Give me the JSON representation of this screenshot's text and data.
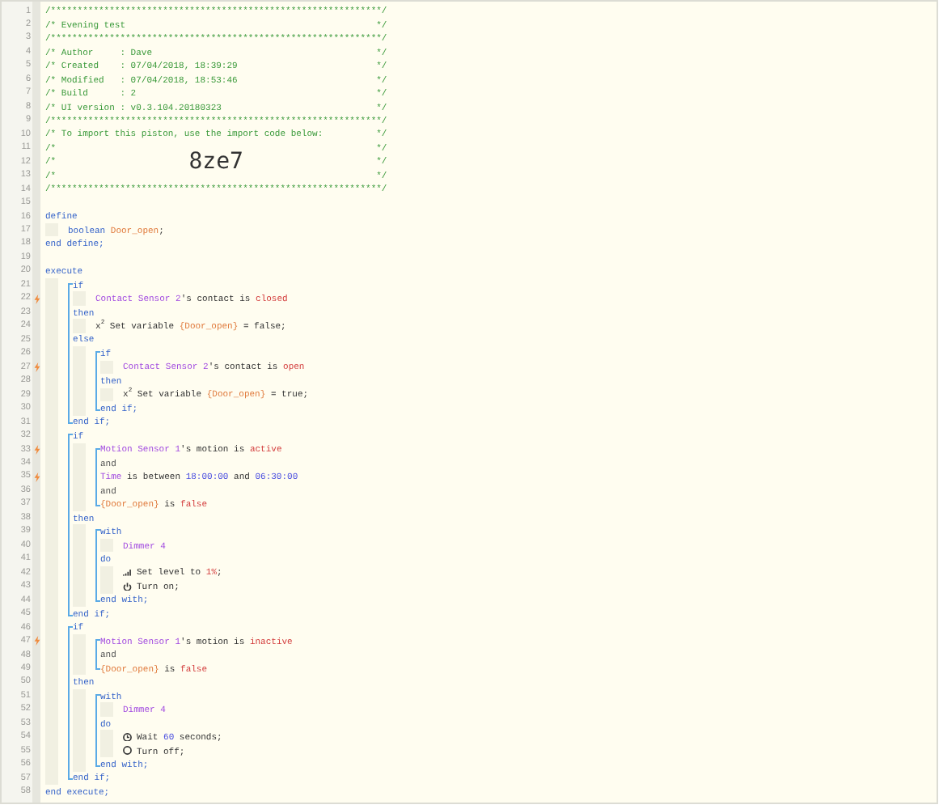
{
  "editor": {
    "lines": [
      {
        "kind": "line",
        "number": "1",
        "trigger": false,
        "tokens": [
          {
            "kind": "comment",
            "text": "/**************************************************************/"
          }
        ]
      },
      {
        "kind": "line",
        "number": "2",
        "trigger": false,
        "tokens": [
          {
            "kind": "comment",
            "text": "/* Evening test"
          },
          {
            "kind": "comment-end",
            "text": "*/"
          }
        ]
      },
      {
        "kind": "line",
        "number": "3",
        "trigger": false,
        "tokens": [
          {
            "kind": "comment",
            "text": "/**************************************************************/"
          }
        ]
      },
      {
        "kind": "line",
        "number": "4",
        "trigger": false,
        "tokens": [
          {
            "kind": "comment",
            "text": "/* Author     : Dave"
          },
          {
            "kind": "comment-end",
            "text": "*/"
          }
        ]
      },
      {
        "kind": "line",
        "number": "5",
        "trigger": false,
        "tokens": [
          {
            "kind": "comment",
            "text": "/* Created    : 07/04/2018, 18:39:29"
          },
          {
            "kind": "comment-end",
            "text": "*/"
          }
        ]
      },
      {
        "kind": "line",
        "number": "6",
        "trigger": false,
        "tokens": [
          {
            "kind": "comment",
            "text": "/* Modified   : 07/04/2018, 18:53:46"
          },
          {
            "kind": "comment-end",
            "text": "*/"
          }
        ]
      },
      {
        "kind": "line",
        "number": "7",
        "trigger": false,
        "tokens": [
          {
            "kind": "comment",
            "text": "/* Build      : 2"
          },
          {
            "kind": "comment-end",
            "text": "*/"
          }
        ]
      },
      {
        "kind": "line",
        "number": "8",
        "trigger": false,
        "tokens": [
          {
            "kind": "comment",
            "text": "/* UI version : v0.3.104.20180323"
          },
          {
            "kind": "comment-end",
            "text": "*/"
          }
        ]
      },
      {
        "kind": "line",
        "number": "9",
        "trigger": false,
        "tokens": [
          {
            "kind": "comment",
            "text": "/**************************************************************/"
          }
        ]
      },
      {
        "kind": "line",
        "number": "10",
        "trigger": false,
        "tokens": [
          {
            "kind": "comment",
            "text": "/* To import this piston, use the import code below:"
          },
          {
            "kind": "comment-end",
            "text": "*/"
          }
        ]
      },
      {
        "kind": "line",
        "number": "11",
        "trigger": false,
        "tokens": [
          {
            "kind": "comment",
            "text": "/*"
          },
          {
            "kind": "comment-end",
            "text": "*/"
          }
        ]
      },
      {
        "kind": "line",
        "number": "12",
        "trigger": false,
        "tokens": [
          {
            "kind": "comment",
            "text": "/*"
          },
          {
            "kind": "import-code",
            "text": "8ze7"
          },
          {
            "kind": "comment-end",
            "text": "*/"
          }
        ]
      },
      {
        "kind": "line",
        "number": "13",
        "trigger": false,
        "tokens": [
          {
            "kind": "comment",
            "text": "/*"
          },
          {
            "kind": "comment-end",
            "text": "*/"
          }
        ]
      },
      {
        "kind": "line",
        "number": "14",
        "trigger": false,
        "tokens": [
          {
            "kind": "comment",
            "text": "/**************************************************************/"
          }
        ]
      },
      {
        "kind": "line",
        "number": "15",
        "trigger": false
      },
      {
        "kind": "line",
        "number": "16",
        "trigger": false,
        "tokens": [
          {
            "kind": "keyword",
            "text": "define"
          }
        ]
      },
      {
        "kind": "indent",
        "children": [
          {
            "kind": "line",
            "number": "17",
            "trigger": false,
            "tokens": [
              {
                "kind": "keyword",
                "text": "boolean "
              },
              {
                "kind": "variable",
                "text": "Door_open"
              },
              {
                "kind": "plain",
                "text": ";"
              }
            ]
          }
        ]
      },
      {
        "kind": "line",
        "number": "18",
        "trigger": false,
        "tokens": [
          {
            "kind": "keyword",
            "text": "end define;"
          }
        ]
      },
      {
        "kind": "line",
        "number": "19",
        "trigger": false
      },
      {
        "kind": "line",
        "number": "20",
        "trigger": false,
        "tokens": [
          {
            "kind": "keyword",
            "text": "execute"
          }
        ]
      },
      {
        "kind": "indent",
        "children": [
          {
            "kind": "bracket",
            "children": [
              {
                "kind": "line",
                "number": "21",
                "trigger": false,
                "tokens": [
                  {
                    "kind": "keyword",
                    "text": "if"
                  }
                ]
              },
              {
                "kind": "indent",
                "children": [
                  {
                    "kind": "line",
                    "number": "22",
                    "trigger": true,
                    "tokens": [
                      {
                        "kind": "device",
                        "text": "Contact Sensor 2"
                      },
                      {
                        "kind": "plain",
                        "text": "'s contact is "
                      },
                      {
                        "kind": "value",
                        "text": "closed"
                      }
                    ]
                  }
                ]
              },
              {
                "kind": "line",
                "number": "23",
                "trigger": false,
                "tokens": [
                  {
                    "kind": "keyword",
                    "text": "then"
                  }
                ]
              },
              {
                "kind": "indent",
                "children": [
                  {
                    "kind": "line",
                    "number": "24",
                    "trigger": false,
                    "tokens": [
                      {
                        "kind": "plain",
                        "text": "x$^{2}$ Set variable "
                      },
                      {
                        "kind": "variable",
                        "text": "{Door_open}"
                      },
                      {
                        "kind": "plain",
                        "text": " = false;"
                      }
                    ]
                  }
                ]
              },
              {
                "kind": "line",
                "number": "25",
                "trigger": false,
                "tokens": [
                  {
                    "kind": "keyword",
                    "text": "else"
                  }
                ]
              },
              {
                "kind": "indent",
                "children": [
                  {
                    "kind": "bracket",
                    "children": [
                      {
                        "kind": "line",
                        "number": "26",
                        "trigger": false,
                        "tokens": [
                          {
                            "kind": "keyword",
                            "text": "if"
                          }
                        ]
                      },
                      {
                        "kind": "indent",
                        "children": [
                          {
                            "kind": "line",
                            "number": "27",
                            "trigger": true,
                            "tokens": [
                              {
                                "kind": "device",
                                "text": "Contact Sensor 2"
                              },
                              {
                                "kind": "plain",
                                "text": "'s contact is "
                              },
                              {
                                "kind": "value",
                                "text": "open"
                              }
                            ]
                          }
                        ]
                      },
                      {
                        "kind": "line",
                        "number": "28",
                        "trigger": false,
                        "tokens": [
                          {
                            "kind": "keyword",
                            "text": "then"
                          }
                        ]
                      },
                      {
                        "kind": "indent",
                        "children": [
                          {
                            "kind": "line",
                            "number": "29",
                            "trigger": false,
                            "tokens": [
                              {
                                "kind": "plain",
                                "text": "x$^{2}$ Set variable "
                              },
                              {
                                "kind": "variable",
                                "text": "{Door_open}"
                              },
                              {
                                "kind": "plain",
                                "text": " = true;"
                              }
                            ]
                          }
                        ]
                      },
                      {
                        "kind": "line",
                        "number": "30",
                        "trigger": false,
                        "tokens": [
                          {
                            "kind": "keyword",
                            "text": "end if;"
                          }
                        ]
                      }
                    ]
                  }
                ]
              },
              {
                "kind": "line",
                "number": "31",
                "trigger": false,
                "tokens": [
                  {
                    "kind": "keyword",
                    "text": "end if;"
                  }
                ]
              }
            ]
          },
          {
            "kind": "bracket",
            "children": [
              {
                "kind": "line",
                "number": "32",
                "trigger": false,
                "tokens": [
                  {
                    "kind": "keyword",
                    "text": "if"
                  }
                ]
              },
              {
                "kind": "indent",
                "children": [
                  {
                    "kind": "bracket",
                    "children": [
                      {
                        "kind": "line",
                        "number": "33",
                        "trigger": true,
                        "tokens": [
                          {
                            "kind": "device",
                            "text": "Motion Sensor 1"
                          },
                          {
                            "kind": "plain",
                            "text": "'s motion is "
                          },
                          {
                            "kind": "value",
                            "text": "active"
                          }
                        ]
                      },
                      {
                        "kind": "line",
                        "number": "34",
                        "trigger": false,
                        "tokens": [
                          {
                            "kind": "operator",
                            "text": "and"
                          }
                        ]
                      },
                      {
                        "kind": "line",
                        "number": "35",
                        "trigger": true,
                        "tokens": [
                          {
                            "kind": "device",
                            "text": "Time"
                          },
                          {
                            "kind": "plain",
                            "text": " is between "
                          },
                          {
                            "kind": "number",
                            "text": "18:00:00"
                          },
                          {
                            "kind": "plain",
                            "text": " and "
                          },
                          {
                            "kind": "number",
                            "text": "06:30:00"
                          }
                        ]
                      },
                      {
                        "kind": "line",
                        "number": "36",
                        "trigger": false,
                        "tokens": [
                          {
                            "kind": "operator",
                            "text": "and"
                          }
                        ]
                      },
                      {
                        "kind": "line",
                        "number": "37",
                        "trigger": false,
                        "tokens": [
                          {
                            "kind": "variable",
                            "text": "{Door_open}"
                          },
                          {
                            "kind": "plain",
                            "text": " is "
                          },
                          {
                            "kind": "value",
                            "text": "false"
                          }
                        ]
                      }
                    ]
                  }
                ]
              },
              {
                "kind": "line",
                "number": "38",
                "trigger": false,
                "tokens": [
                  {
                    "kind": "keyword",
                    "text": "then"
                  }
                ]
              },
              {
                "kind": "indent",
                "children": [
                  {
                    "kind": "bracket",
                    "children": [
                      {
                        "kind": "line",
                        "number": "39",
                        "trigger": false,
                        "tokens": [
                          {
                            "kind": "keyword",
                            "text": "with"
                          }
                        ]
                      },
                      {
                        "kind": "indent",
                        "children": [
                          {
                            "kind": "line",
                            "number": "40",
                            "trigger": false,
                            "tokens": [
                              {
                                "kind": "device",
                                "text": "Dimmer 4"
                              }
                            ]
                          }
                        ]
                      },
                      {
                        "kind": "line",
                        "number": "41",
                        "trigger": false,
                        "tokens": [
                          {
                            "kind": "keyword",
                            "text": "do"
                          }
                        ]
                      },
                      {
                        "kind": "indent",
                        "children": [
                          {
                            "kind": "line",
                            "number": "42",
                            "trigger": false,
                            "tokens": [
                              {
                                "kind": "set-level"
                              },
                              {
                                "kind": "plain",
                                "text": "Set level to "
                              },
                              {
                                "kind": "value",
                                "text": "1%"
                              },
                              {
                                "kind": "plain",
                                "text": ";"
                              }
                            ]
                          },
                          {
                            "kind": "line",
                            "number": "43",
                            "trigger": false,
                            "tokens": [
                              {
                                "kind": "turn-on"
                              },
                              {
                                "kind": "plain",
                                "text": "Turn on;"
                              }
                            ]
                          }
                        ]
                      },
                      {
                        "kind": "line",
                        "number": "44",
                        "trigger": false,
                        "tokens": [
                          {
                            "kind": "keyword",
                            "text": "end with;"
                          }
                        ]
                      }
                    ]
                  }
                ]
              },
              {
                "kind": "line",
                "number": "45",
                "trigger": false,
                "tokens": [
                  {
                    "kind": "keyword",
                    "text": "end if;"
                  }
                ]
              }
            ]
          },
          {
            "kind": "bracket",
            "children": [
              {
                "kind": "line",
                "number": "46",
                "trigger": false,
                "tokens": [
                  {
                    "kind": "keyword",
                    "text": "if"
                  }
                ]
              },
              {
                "kind": "indent",
                "children": [
                  {
                    "kind": "bracket",
                    "children": [
                      {
                        "kind": "line",
                        "number": "47",
                        "trigger": true,
                        "tokens": [
                          {
                            "kind": "device",
                            "text": "Motion Sensor 1"
                          },
                          {
                            "kind": "plain",
                            "text": "'s motion is "
                          },
                          {
                            "kind": "value",
                            "text": "inactive"
                          }
                        ]
                      },
                      {
                        "kind": "line",
                        "number": "48",
                        "trigger": false,
                        "tokens": [
                          {
                            "kind": "operator",
                            "text": "and"
                          }
                        ]
                      },
                      {
                        "kind": "line",
                        "number": "49",
                        "trigger": false,
                        "tokens": [
                          {
                            "kind": "variable",
                            "text": "{Door_open}"
                          },
                          {
                            "kind": "plain",
                            "text": " is "
                          },
                          {
                            "kind": "value",
                            "text": "false"
                          }
                        ]
                      }
                    ]
                  }
                ]
              },
              {
                "kind": "line",
                "number": "50",
                "trigger": false,
                "tokens": [
                  {
                    "kind": "keyword",
                    "text": "then"
                  }
                ]
              },
              {
                "kind": "indent",
                "children": [
                  {
                    "kind": "bracket",
                    "children": [
                      {
                        "kind": "line",
                        "number": "51",
                        "trigger": false,
                        "tokens": [
                          {
                            "kind": "keyword",
                            "text": "with"
                          }
                        ]
                      },
                      {
                        "kind": "indent",
                        "children": [
                          {
                            "kind": "line",
                            "number": "52",
                            "trigger": false,
                            "tokens": [
                              {
                                "kind": "device",
                                "text": "Dimmer 4"
                              }
                            ]
                          }
                        ]
                      },
                      {
                        "kind": "line",
                        "number": "53",
                        "trigger": false,
                        "tokens": [
                          {
                            "kind": "keyword",
                            "text": "do"
                          }
                        ]
                      },
                      {
                        "kind": "indent",
                        "children": [
                          {
                            "kind": "line",
                            "number": "54",
                            "trigger": false,
                            "tokens": [
                              {
                                "kind": "wait"
                              },
                              {
                                "kind": "plain",
                                "text": "Wait "
                              },
                              {
                                "kind": "number",
                                "text": "60"
                              },
                              {
                                "kind": "plain",
                                "text": " seconds;"
                              }
                            ]
                          },
                          {
                            "kind": "line",
                            "number": "55",
                            "trigger": false,
                            "tokens": [
                              {
                                "kind": "turn-off"
                              },
                              {
                                "kind": "plain",
                                "text": "Turn off;"
                              }
                            ]
                          }
                        ]
                      },
                      {
                        "kind": "line",
                        "number": "56",
                        "trigger": false,
                        "tokens": [
                          {
                            "kind": "keyword",
                            "text": "end with;"
                          }
                        ]
                      }
                    ]
                  }
                ]
              },
              {
                "kind": "line",
                "number": "57",
                "trigger": false,
                "tokens": [
                  {
                    "kind": "keyword",
                    "text": "end if;"
                  }
                ]
              }
            ]
          }
        ]
      },
      {
        "kind": "line",
        "number": "58",
        "trigger": false,
        "tokens": [
          {
            "kind": "keyword",
            "text": "end execute;"
          }
        ]
      }
    ]
  }
}
